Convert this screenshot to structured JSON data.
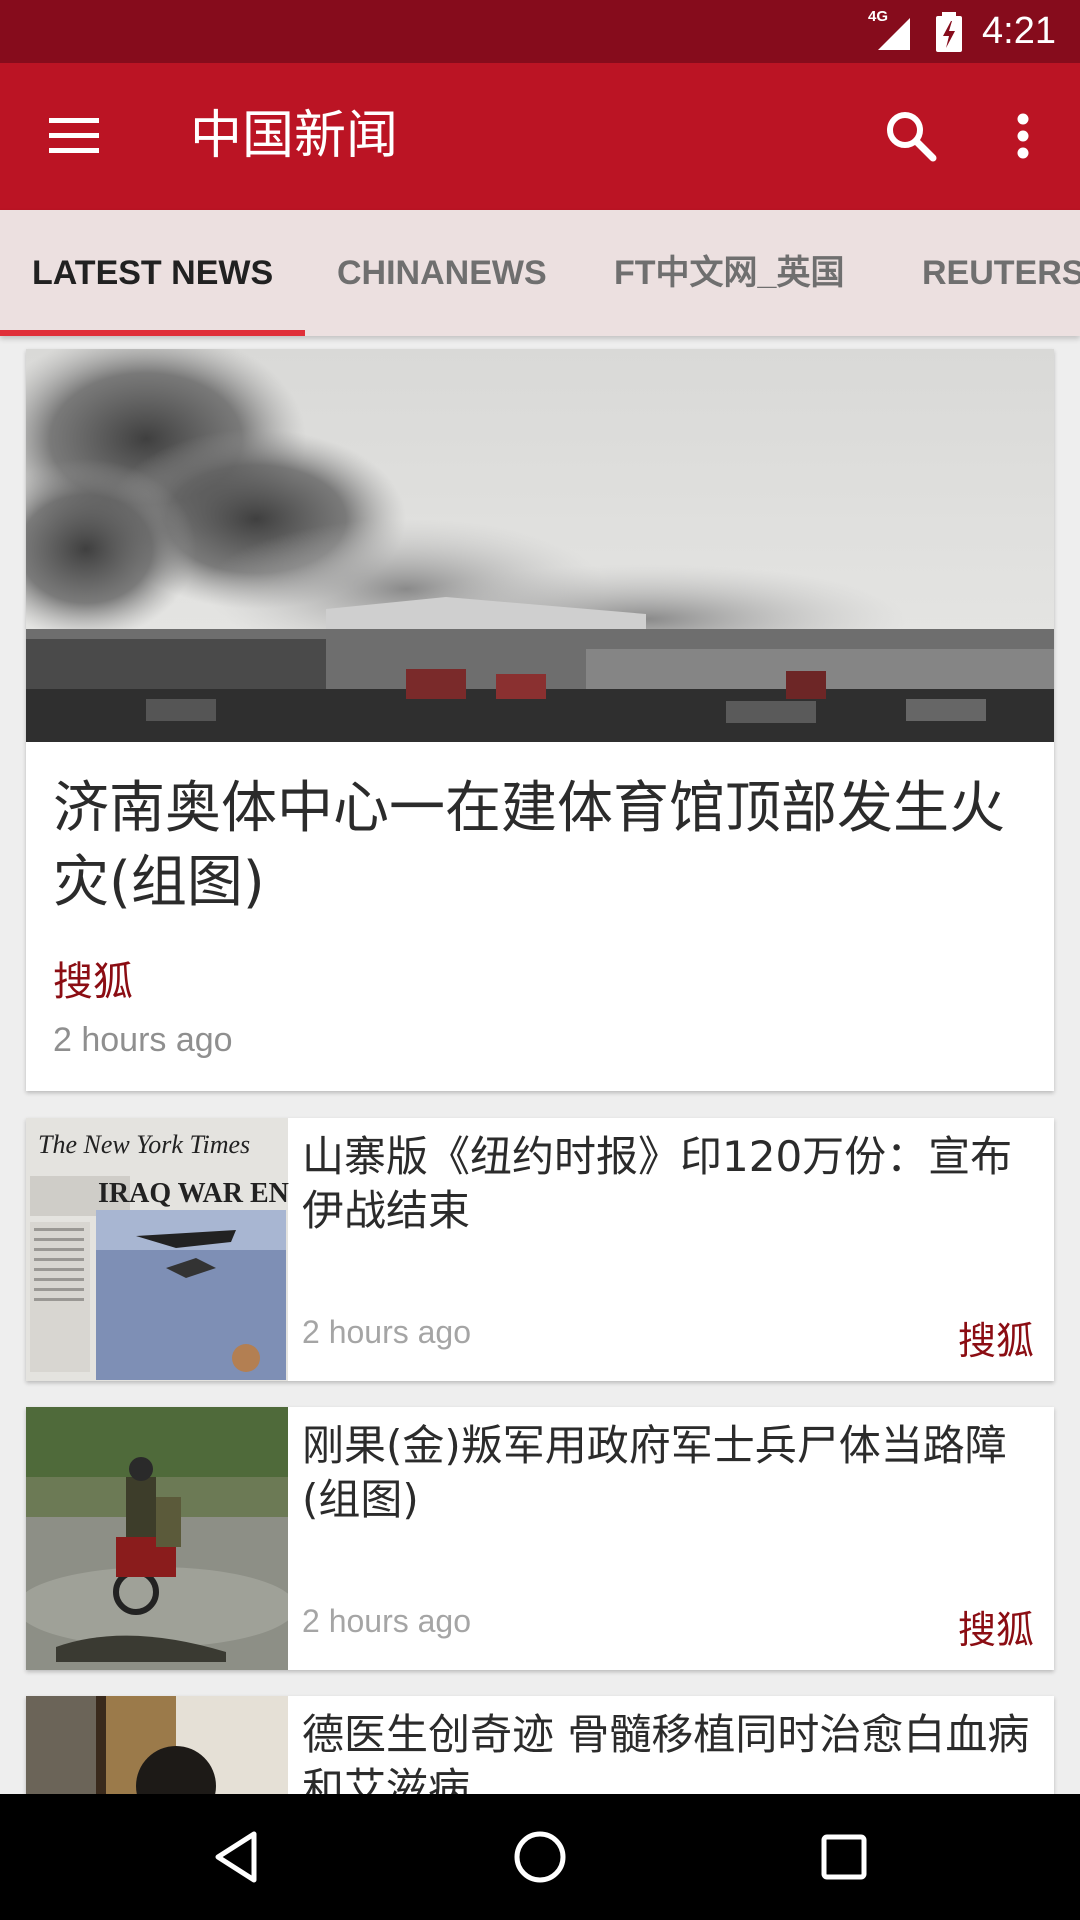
{
  "status": {
    "network": "4G",
    "time": "4:21"
  },
  "app_bar": {
    "title": "中国新闻",
    "icons": [
      "menu-icon",
      "search-icon",
      "more-vert-icon"
    ]
  },
  "tabs": [
    {
      "label": "LATEST NEWS",
      "active": true
    },
    {
      "label": "CHINANEWS",
      "active": false
    },
    {
      "label": "FT中文网_英国",
      "active": false
    },
    {
      "label": "REUTERS",
      "active": false
    }
  ],
  "hero": {
    "title": "济南奥体中心一在建体育馆顶部发生火灾(组图)",
    "source": "搜狐",
    "time": "2 hours ago"
  },
  "items": [
    {
      "title": "山寨版《纽约时报》印120万份：宣布伊战结束",
      "time": "2 hours ago",
      "source": "搜狐",
      "thumb_text": [
        "The New York Times",
        "IRAQ WAR EN"
      ]
    },
    {
      "title": "刚果(金)叛军用政府军士兵尸体当路障(组图)",
      "time": "2 hours ago",
      "source": "搜狐"
    },
    {
      "title": "德医生创奇迹 骨髓移植同时治愈白血病和艾滋病"
    }
  ],
  "colors": {
    "status_bar": "#860c1c",
    "app_bar": "#bb1424",
    "tab_bg": "#ece0e0",
    "tab_indicator": "#e0303a",
    "source_text": "#8b0d13"
  },
  "nav": {
    "icons": [
      "back-icon",
      "home-icon",
      "recents-icon"
    ]
  }
}
